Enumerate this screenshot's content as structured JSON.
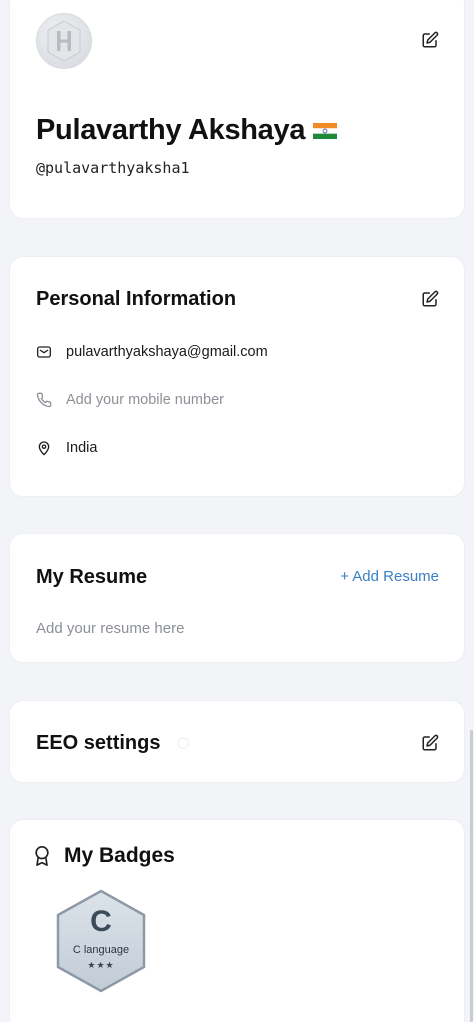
{
  "profile": {
    "name": "Pulavarthy Akshaya",
    "username": "@pulavarthyaksha1",
    "avatar_icon": "hackerrank-logo-icon",
    "flag_icon": "india-flag-icon"
  },
  "personal": {
    "title": "Personal Information",
    "email": "pulavarthyakshaya@gmail.com",
    "phone_placeholder": "Add your mobile number",
    "location": "India"
  },
  "resume": {
    "title": "My Resume",
    "add_label": "+ Add Resume",
    "placeholder": "Add your resume here"
  },
  "eeo": {
    "title": "EEO settings"
  },
  "badges": {
    "title": "My Badges",
    "items": [
      {
        "letter": "C",
        "label": "C language",
        "stars": "★★★"
      }
    ]
  },
  "colors": {
    "background": "#f3f4f8",
    "card": "#ffffff",
    "accent_link": "#3b7fc4",
    "muted_text": "#8c9097"
  }
}
